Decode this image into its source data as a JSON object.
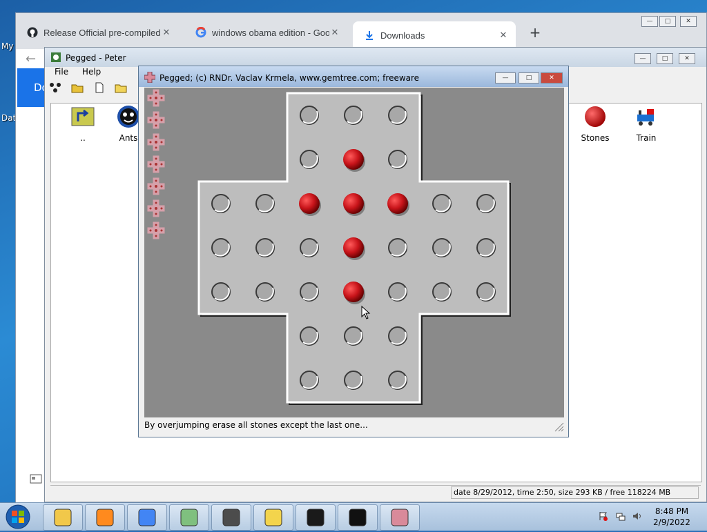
{
  "desktop": {
    "labels": [
      "My",
      "Dat"
    ]
  },
  "browser": {
    "tabs": [
      {
        "label": "Release Official pre-compiled ins",
        "icon": "github-icon"
      },
      {
        "label": "windows obama edition - Google",
        "icon": "google-icon"
      },
      {
        "label": "Downloads",
        "icon": "download-icon"
      }
    ],
    "page_banner": "Do"
  },
  "peter": {
    "title": "Pegged - Peter",
    "menu": [
      "File",
      "Help"
    ],
    "items": [
      {
        "label": "..",
        "icon": "up-folder-icon"
      },
      {
        "label": "Ants",
        "icon": "ants-icon"
      },
      {
        "label": "Stones",
        "icon": "red-ball-icon"
      },
      {
        "label": "Train",
        "icon": "train-icon"
      }
    ],
    "status": "date 8/29/2012, time 2:50, size 293 KB / free 118224 MB"
  },
  "pegged": {
    "title": "Pegged;   (c) RNDr. Vaclav Krmela, www.gemtree.com;   freeware",
    "status": "By overjumping erase all stones except the last one...",
    "board": {
      "cells": [
        [
          2,
          0
        ],
        [
          3,
          0
        ],
        [
          4,
          0
        ],
        [
          2,
          1
        ],
        [
          3,
          1
        ],
        [
          4,
          1
        ],
        [
          0,
          2
        ],
        [
          1,
          2
        ],
        [
          2,
          2
        ],
        [
          3,
          2
        ],
        [
          4,
          2
        ],
        [
          5,
          2
        ],
        [
          6,
          2
        ],
        [
          0,
          3
        ],
        [
          1,
          3
        ],
        [
          2,
          3
        ],
        [
          3,
          3
        ],
        [
          4,
          3
        ],
        [
          5,
          3
        ],
        [
          6,
          3
        ],
        [
          0,
          4
        ],
        [
          1,
          4
        ],
        [
          2,
          4
        ],
        [
          3,
          4
        ],
        [
          4,
          4
        ],
        [
          5,
          4
        ],
        [
          6,
          4
        ],
        [
          2,
          5
        ],
        [
          3,
          5
        ],
        [
          4,
          5
        ],
        [
          2,
          6
        ],
        [
          3,
          6
        ],
        [
          4,
          6
        ]
      ],
      "stones": [
        [
          3,
          1
        ],
        [
          2,
          2
        ],
        [
          3,
          2
        ],
        [
          4,
          2
        ],
        [
          3,
          3
        ],
        [
          3,
          4
        ]
      ]
    },
    "stone_color": "#c8141a",
    "level_icons": 7
  },
  "taskbar": {
    "time": "8:48 PM",
    "date": "2/9/2022",
    "apps": [
      "explorer-icon",
      "media-player-icon",
      "chrome-icon",
      "bunny-icon",
      "alien-icon",
      "x-icon",
      "oscilloscope-icon",
      "cmd-icon",
      "pegged-icon"
    ]
  }
}
